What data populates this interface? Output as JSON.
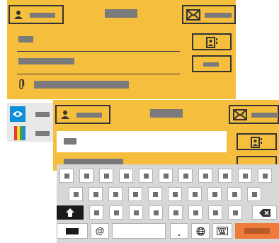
{
  "back_form": {
    "icons": [
      "person-icon",
      "envelope-icon",
      "contact-book-icon",
      "paperclip-icon"
    ]
  },
  "left_strip": {
    "icons": [
      "eye-icon",
      "palette-icon"
    ]
  },
  "front_form": {
    "icons": [
      "person-icon",
      "envelope-icon",
      "contact-book-icon"
    ]
  },
  "keyboard": {
    "at_key": "@",
    "period_key": ".",
    "icons": [
      "shift-icon",
      "backspace-icon",
      "globe-icon",
      "keyboard-icon"
    ],
    "accent_color": "#f07a39"
  },
  "colors": {
    "panel": "#f6be3d",
    "keyboard_bg": "#d7d7d7"
  }
}
